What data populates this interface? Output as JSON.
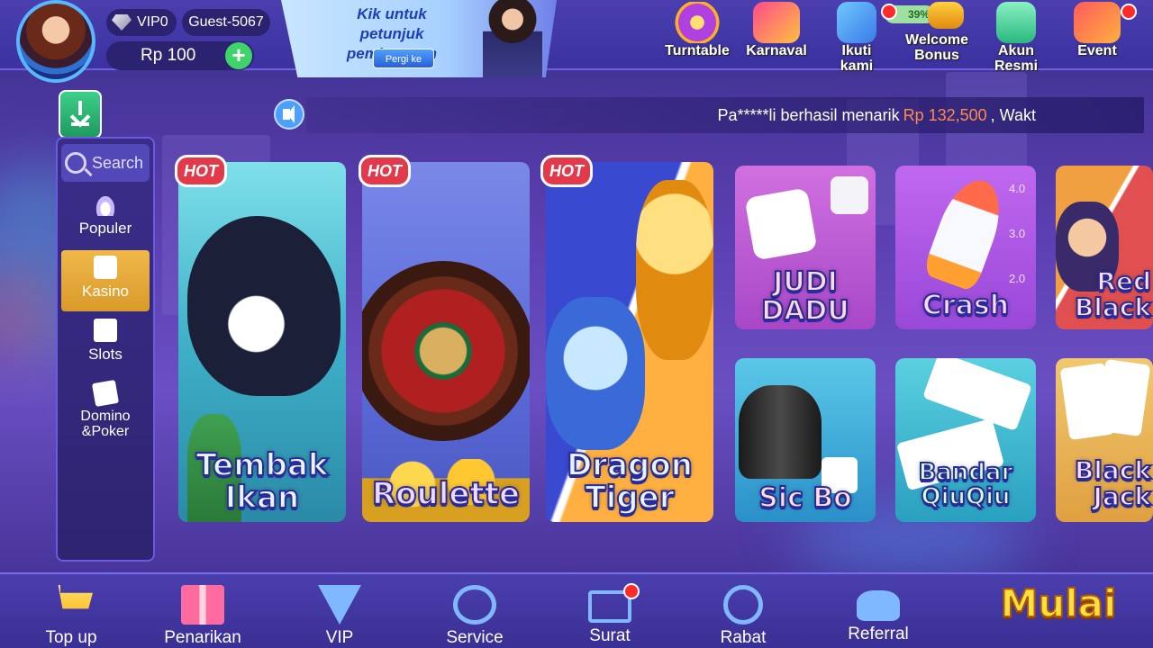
{
  "profile": {
    "vip_label": "VIP0",
    "guest_name": "Guest-5067",
    "balance": "Rp 100",
    "add_label": "+"
  },
  "promo": {
    "text": "Kik untuk petunjuk pembayaran",
    "button": "Pergi ke"
  },
  "top_menu": [
    {
      "label": "Turntable",
      "icon": "turntable-icon"
    },
    {
      "label": "Karnaval",
      "icon": "carnival-gift-icon"
    },
    {
      "label": "Ikuti kami",
      "icon": "follow-us-icon"
    },
    {
      "label": "Welcome Bonus",
      "icon": "treasure-chest-icon"
    },
    {
      "label": "Akun Resmi",
      "icon": "official-account-icon"
    },
    {
      "label": "Event",
      "icon": "event-gift-icon"
    }
  ],
  "welcome_badge": "39%",
  "ticker": {
    "prefix": "Pa*****li berhasil menarik",
    "amount": "Rp 132,500",
    "suffix": ", Wakt"
  },
  "side_nav": {
    "search": "Search",
    "items": [
      {
        "label": "Populer",
        "icon": "flame-icon"
      },
      {
        "label": "Kasino",
        "icon": "dice-icon"
      },
      {
        "label": "Slots",
        "icon": "slot-seven-icon"
      },
      {
        "label": "Domino &Poker",
        "icon": "cards-icon"
      }
    ]
  },
  "hot_label": "HOT",
  "games_large": [
    {
      "title_1": "Tembak",
      "title_2": "Ikan"
    },
    {
      "title_1": "Roulette",
      "title_2": ""
    },
    {
      "title_1": "Dragon",
      "title_2": "Tiger"
    }
  ],
  "games_small": [
    {
      "title_1": "JUDI",
      "title_2": "DADU"
    },
    {
      "title_1": "Crash",
      "title_2": ""
    },
    {
      "title_1": "Red",
      "title_2": "Black"
    },
    {
      "title_1": "Sic Bo",
      "title_2": ""
    },
    {
      "title_1": "Bandar",
      "title_2": "QiuQiu"
    },
    {
      "title_1": "Black",
      "title_2": "Jack"
    }
  ],
  "crash_ticks": [
    "4.0",
    "3.0",
    "2.0"
  ],
  "bottom_nav": [
    {
      "label": "Top up",
      "icon": "cart-plus-icon"
    },
    {
      "label": "Penarikan",
      "icon": "gift-box-icon"
    },
    {
      "label": "VIP",
      "icon": "vip-diamond-icon"
    },
    {
      "label": "Service",
      "icon": "headset-icon"
    },
    {
      "label": "Surat",
      "icon": "mail-icon"
    },
    {
      "label": "Rabat",
      "icon": "rebate-coin-icon"
    },
    {
      "label": "Referral",
      "icon": "handshake-icon"
    }
  ],
  "start_label": "Mulai",
  "colors": {
    "accent_gold": "#ffe040",
    "ticker_amount": "#ff8a4a",
    "hot_red": "#e23a4a",
    "nav_active": "#f0b84a"
  }
}
